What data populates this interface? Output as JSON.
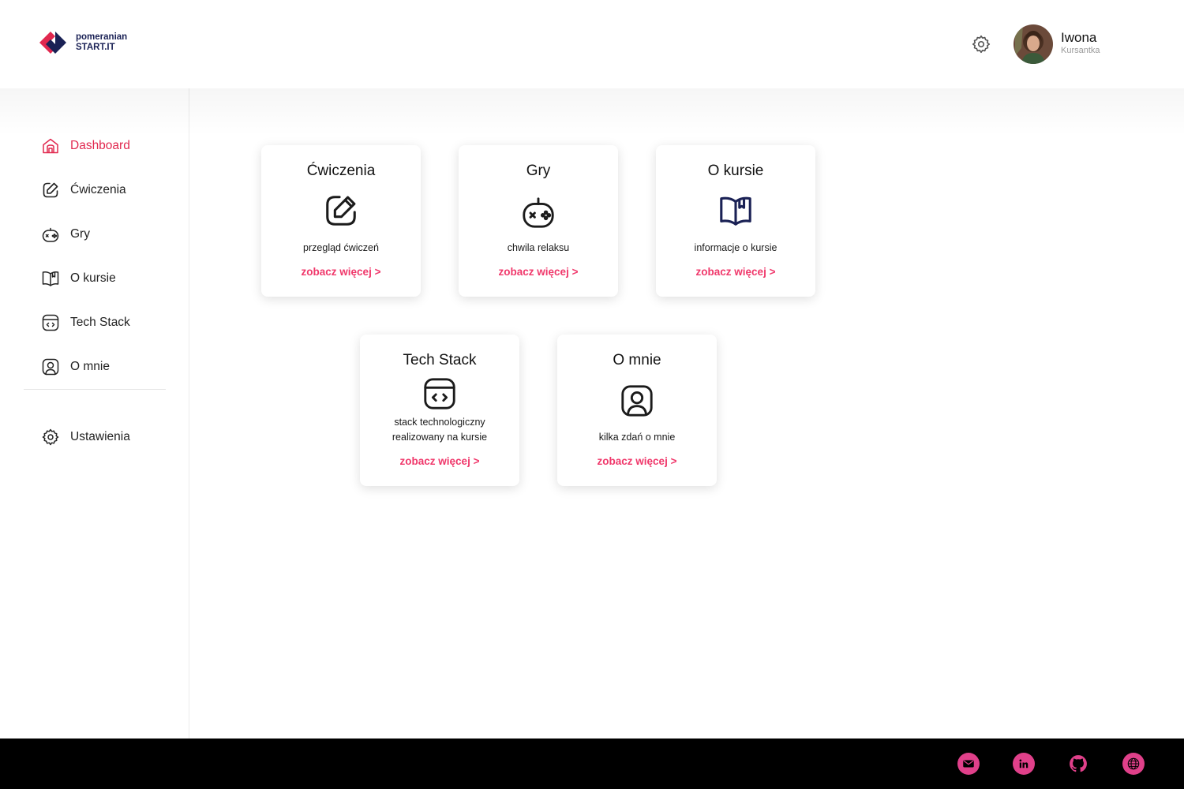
{
  "brand": {
    "line1": "pomeranian",
    "line2": "START.IT",
    "logo_colors": [
      "#e1284f",
      "#1a2155"
    ]
  },
  "header": {
    "settings_icon": "gear-icon",
    "user": {
      "name": "Iwona",
      "role": "Kursantka"
    }
  },
  "sidebar": {
    "items": [
      {
        "label": "Dashboard",
        "icon": "home-icon",
        "active": true
      },
      {
        "label": "Ćwiczenia",
        "icon": "edit-icon",
        "active": false
      },
      {
        "label": "Gry",
        "icon": "gamepad-icon",
        "active": false
      },
      {
        "label": "O kursie",
        "icon": "book-icon",
        "active": false
      },
      {
        "label": "Tech Stack",
        "icon": "code-window-icon",
        "active": false
      },
      {
        "label": "O mnie",
        "icon": "user-icon",
        "active": false
      }
    ],
    "settings": {
      "label": "Ustawienia",
      "icon": "gear-icon"
    }
  },
  "cards": [
    {
      "title": "Ćwiczenia",
      "icon": "edit-icon",
      "desc": "przegląd ćwiczeń",
      "link": "zobacz więcej >"
    },
    {
      "title": "Gry",
      "icon": "gamepad-icon",
      "desc": "chwila relaksu",
      "link": "zobacz więcej >"
    },
    {
      "title": "O kursie",
      "icon": "book-icon",
      "desc": "informacje o kursie",
      "link": "zobacz więcej >"
    },
    {
      "title": "Tech Stack",
      "icon": "code-window-icon",
      "desc": "stack technologiczny realizowany na kursie",
      "link": "zobacz więcej >"
    },
    {
      "title": "O mnie",
      "icon": "user-icon",
      "desc": "kilka zdań o mnie",
      "link": "zobacz więcej >"
    }
  ],
  "footer": {
    "icons": [
      "mail-icon",
      "linkedin-icon",
      "github-icon",
      "globe-icon"
    ],
    "accent": "#e0408a"
  },
  "colors": {
    "accent": "#f0386b",
    "active_nav": "#e1284f",
    "footer_bg": "#000000"
  }
}
